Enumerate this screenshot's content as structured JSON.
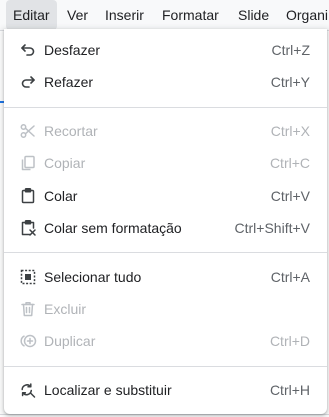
{
  "menubar": {
    "items": [
      "Editar",
      "Ver",
      "Inserir",
      "Formatar",
      "Slide",
      "Organi"
    ]
  },
  "edit_menu": {
    "items": [
      {
        "label": "Desfazer",
        "shortcut": "Ctrl+Z",
        "icon": "undo-icon",
        "enabled": true
      },
      {
        "label": "Refazer",
        "shortcut": "Ctrl+Y",
        "icon": "redo-icon",
        "enabled": true
      },
      {
        "label": "Recortar",
        "shortcut": "Ctrl+X",
        "icon": "scissors-icon",
        "enabled": false
      },
      {
        "label": "Copiar",
        "shortcut": "Ctrl+C",
        "icon": "copy-icon",
        "enabled": false
      },
      {
        "label": "Colar",
        "shortcut": "Ctrl+V",
        "icon": "clipboard-icon",
        "enabled": true
      },
      {
        "label": "Colar sem formatação",
        "shortcut": "Ctrl+Shift+V",
        "icon": "clipboard-unformatted-icon",
        "enabled": true
      },
      {
        "label": "Selecionar tudo",
        "shortcut": "Ctrl+A",
        "icon": "select-all-icon",
        "enabled": true
      },
      {
        "label": "Excluir",
        "shortcut": "",
        "icon": "trash-icon",
        "enabled": false
      },
      {
        "label": "Duplicar",
        "shortcut": "Ctrl+D",
        "icon": "duplicate-icon",
        "enabled": false
      },
      {
        "label": "Localizar e substituir",
        "shortcut": "Ctrl+H",
        "icon": "find-replace-icon",
        "enabled": true
      }
    ]
  }
}
